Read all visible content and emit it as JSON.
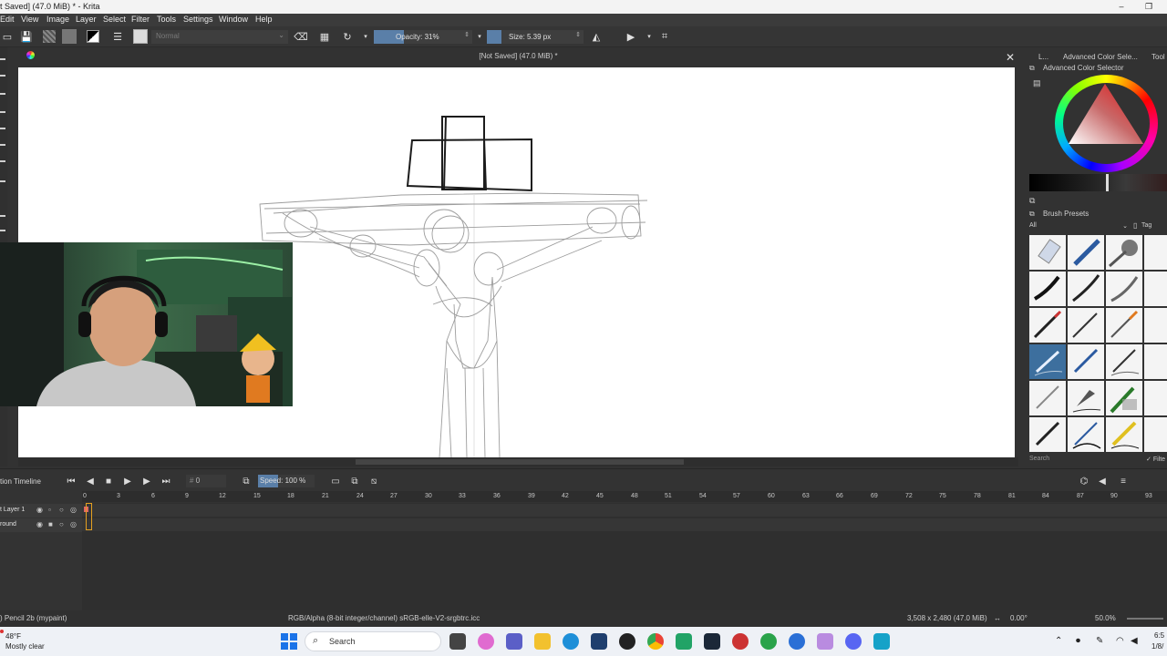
{
  "window": {
    "title": "t Saved]  (47.0 MiB) * - Krita",
    "minimize": "–",
    "restore": "❐"
  },
  "menu": [
    "Edit",
    "View",
    "Image",
    "Layer",
    "Select",
    "Filter",
    "Tools",
    "Settings",
    "Window",
    "Help"
  ],
  "toolbar": {
    "blend_mode": "Normal",
    "opacity_label": "Opacity: 31%",
    "opacity_fraction": 0.31,
    "size_label": "Size: 5.39 px"
  },
  "document": {
    "tab_title": "[Not Saved]  (47.0 MiB) *",
    "close_glyph": "✕"
  },
  "right_dock": {
    "tab_left": "L...",
    "tab_color": "Advanced Color Sele...",
    "tab_tool": "Tool",
    "color_panel_title": "Advanced Color Selector",
    "brush_panel_title": "Brush Presets",
    "brush_filter": "All",
    "tag_label": "Tag",
    "search_placeholder": "Search",
    "filter_label": "Filte"
  },
  "timeline": {
    "title": "tion Timeline",
    "frame_value": "0",
    "speed_label": "Speed:",
    "speed_value": "100 %",
    "ticks": [
      "0",
      "3",
      "6",
      "9",
      "12",
      "15",
      "18",
      "21",
      "24",
      "27",
      "30",
      "33",
      "36",
      "39",
      "42",
      "45",
      "48",
      "51",
      "54",
      "57",
      "60",
      "63",
      "66",
      "69",
      "72",
      "75",
      "78",
      "81",
      "84",
      "87",
      "90",
      "93"
    ],
    "layers": [
      {
        "name": "t Layer 1"
      },
      {
        "name": "round"
      }
    ]
  },
  "status": {
    "brush": ") Pencil 2b (mypaint)",
    "color_profile": "RGB/Alpha (8-bit integer/channel)  sRGB-elle-V2-srgbtrc.icc",
    "dimensions": "3,508 x 2,480 (47.0 MiB)",
    "rotation": "0.00°",
    "zoom": "50.0%"
  },
  "taskbar": {
    "temperature": "48°F",
    "weather": "Mostly clear",
    "search_label": "Search",
    "time": "6:5",
    "date": "1/8/"
  },
  "colors": {
    "accent": "#5a7fa8",
    "panel": "#323232",
    "canvas": "#ffffff",
    "playhead": "#e4a020"
  }
}
